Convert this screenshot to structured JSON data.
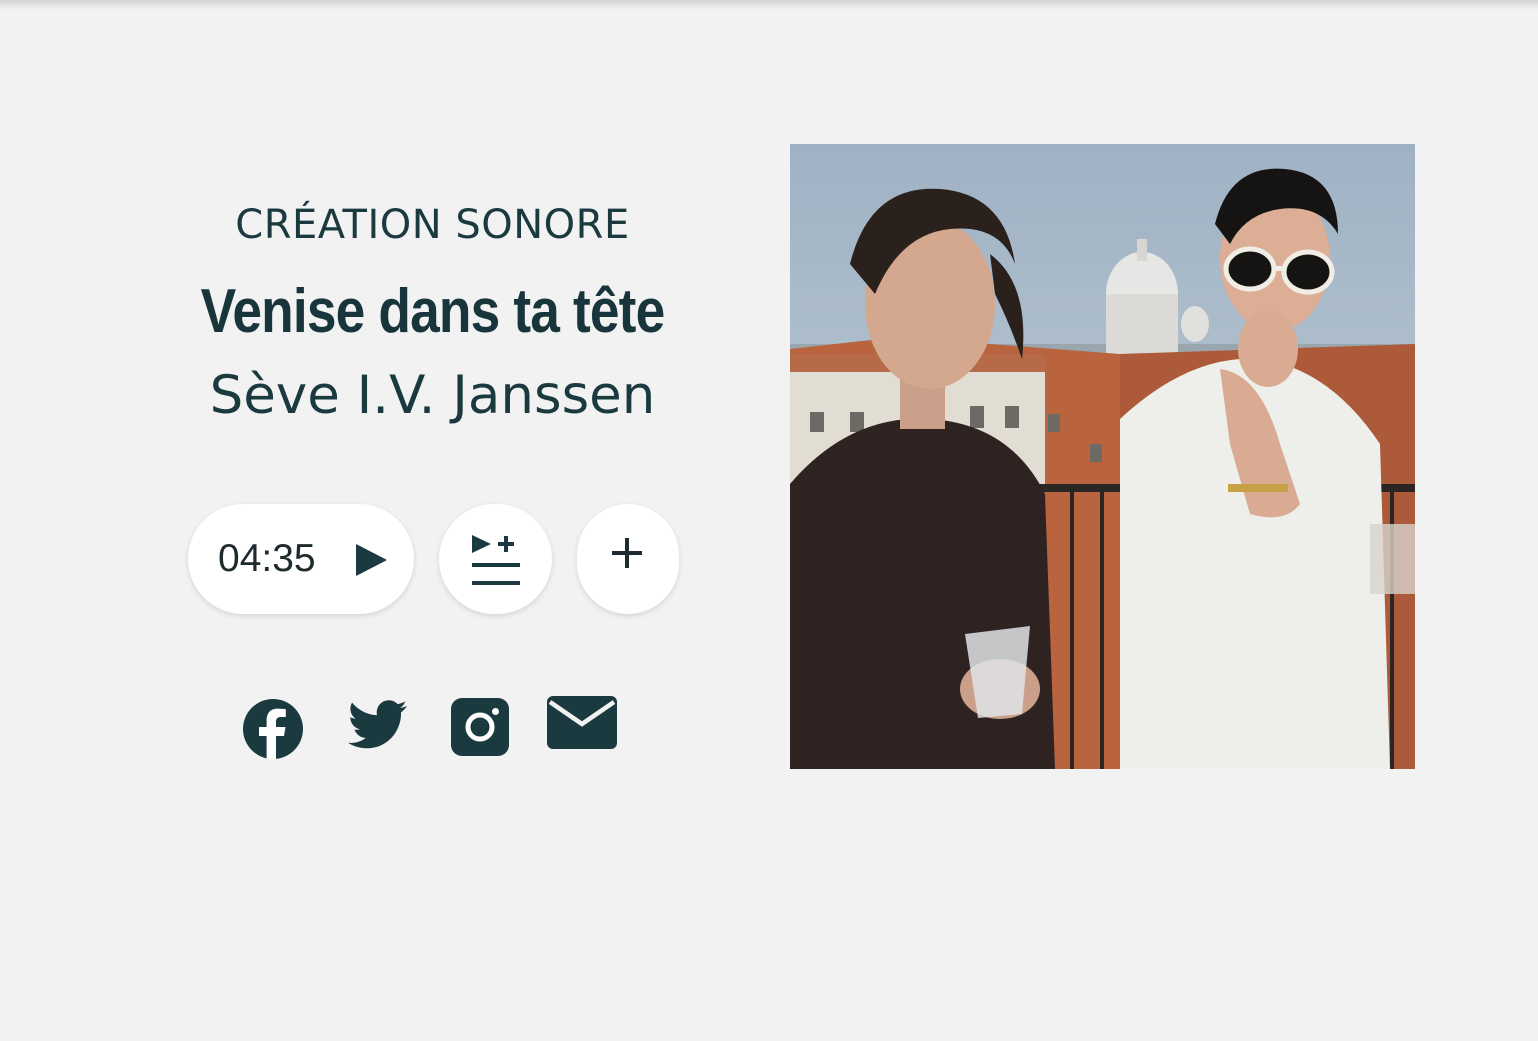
{
  "episode": {
    "category": "CRÉATION SONORE",
    "title": "Venise dans ta tête",
    "author": "Sève I.V. Janssen"
  },
  "player": {
    "duration": "04:35",
    "play_icon": "play-icon",
    "queue_icon": "add-to-queue-icon",
    "add_icon": "plus-icon"
  },
  "share": {
    "icons": [
      "facebook-icon",
      "twitter-icon",
      "instagram-icon",
      "email-icon"
    ]
  },
  "colors": {
    "background": "#f2f2f2",
    "text": "#1b3a40",
    "button_bg": "#ffffff"
  }
}
